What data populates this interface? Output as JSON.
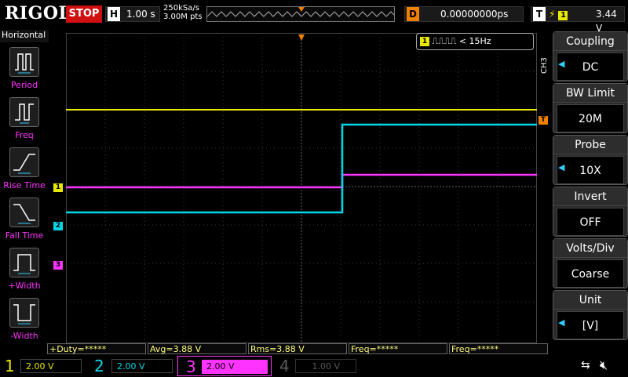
{
  "topbar": {
    "brand": "RIGOL",
    "run_state": "STOP",
    "timebase_key": "H",
    "timebase_value": "1.00 s",
    "sample_rate": "250kSa/s",
    "memory_depth": "3.00M pts",
    "delay_key": "D",
    "delay_value": "0.00000000ps",
    "trigger_key": "T",
    "trigger_source": "1",
    "trigger_level": "3.44 V"
  },
  "left_menu": {
    "title": "Horizontal",
    "items": [
      {
        "label": "Period",
        "icon": "period-icon"
      },
      {
        "label": "Freq",
        "icon": "freq-icon"
      },
      {
        "label": "Rise Time",
        "icon": "rise-time-icon"
      },
      {
        "label": "Fall Time",
        "icon": "fall-time-icon"
      },
      {
        "label": "+Width",
        "icon": "positive-width-icon"
      },
      {
        "label": "-Width",
        "icon": "negative-width-icon"
      }
    ]
  },
  "freq_counter": {
    "channel": "1",
    "value": "< 15Hz"
  },
  "channel_tag": "CH3",
  "right_menu": {
    "items": [
      {
        "title": "Coupling",
        "value": "DC"
      },
      {
        "title": "BW Limit",
        "value": "20M"
      },
      {
        "title": "Probe",
        "value": "10X"
      },
      {
        "title": "Invert",
        "value": "OFF"
      },
      {
        "title": "Volts/Div",
        "value": "Coarse"
      },
      {
        "title": "Unit",
        "value": "[V]"
      }
    ]
  },
  "measurements": [
    {
      "label": "+Duty=*****"
    },
    {
      "label": "Avg=3.88 V"
    },
    {
      "label": "Rms=3.88 V"
    },
    {
      "label": "Freq=*****"
    },
    {
      "label": "Freq=*****"
    }
  ],
  "channels": [
    {
      "num": "1",
      "scale": "2.00 V",
      "color": "#e8e800"
    },
    {
      "num": "2",
      "scale": "2.00 V",
      "color": "#00d8e8"
    },
    {
      "num": "3",
      "scale": "2.00 V",
      "color": "#ff33ff"
    },
    {
      "num": "4",
      "scale": "1.00 V",
      "color": "#5a5a5a"
    }
  ],
  "markers": {
    "ch1": "1",
    "ch2": "2",
    "ch3": "3",
    "trigger": "T"
  }
}
